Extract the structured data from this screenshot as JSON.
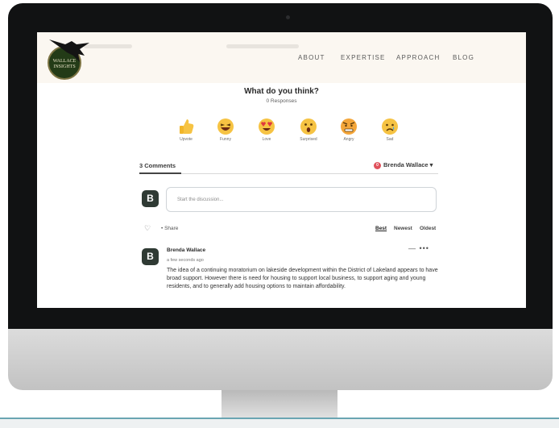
{
  "site": {
    "logo_text_line1": "WALLACE",
    "logo_text_line2": "INSIGHTS",
    "nav": [
      "ABOUT",
      "EXPERTISE",
      "APPROACH",
      "BLOG"
    ]
  },
  "reactions_section": {
    "title": "What do you think?",
    "responses": "0 Responses",
    "items": [
      {
        "label": "Upvote",
        "icon": "thumbs-up-icon"
      },
      {
        "label": "Funny",
        "icon": "laughing-face-icon"
      },
      {
        "label": "Love",
        "icon": "heart-eyes-face-icon"
      },
      {
        "label": "Surprised",
        "icon": "surprised-face-icon"
      },
      {
        "label": "Angry",
        "icon": "angry-face-icon"
      },
      {
        "label": "Sad",
        "icon": "sad-face-icon"
      }
    ]
  },
  "comments": {
    "count_label": "3 Comments",
    "current_user": {
      "badge": "0",
      "name": "Brenda Wallace ▾"
    },
    "avatar_letter": "B",
    "placeholder": "Start the discussion...",
    "favorite_icon": "heart-outline-icon",
    "share_label": "• Share",
    "sort": [
      "Best",
      "Newest",
      "Oldest"
    ],
    "items": [
      {
        "avatar": "B",
        "author": "Brenda Wallace",
        "time": "a few seconds ago",
        "menu": "—  •••",
        "text": "The idea of a continuing moratorium on lakeside development within the District of Lakeland appears to have broad support. However there is need for housing to support local business, to support aging and young residents, and to generally add housing options to maintain affordability."
      }
    ]
  },
  "colors": {
    "bezel": "#111213",
    "header_bg": "#fbf7f1",
    "logo_green": "#233b17",
    "avatar": "#2f3a34",
    "user_badge": "#e0515b"
  }
}
